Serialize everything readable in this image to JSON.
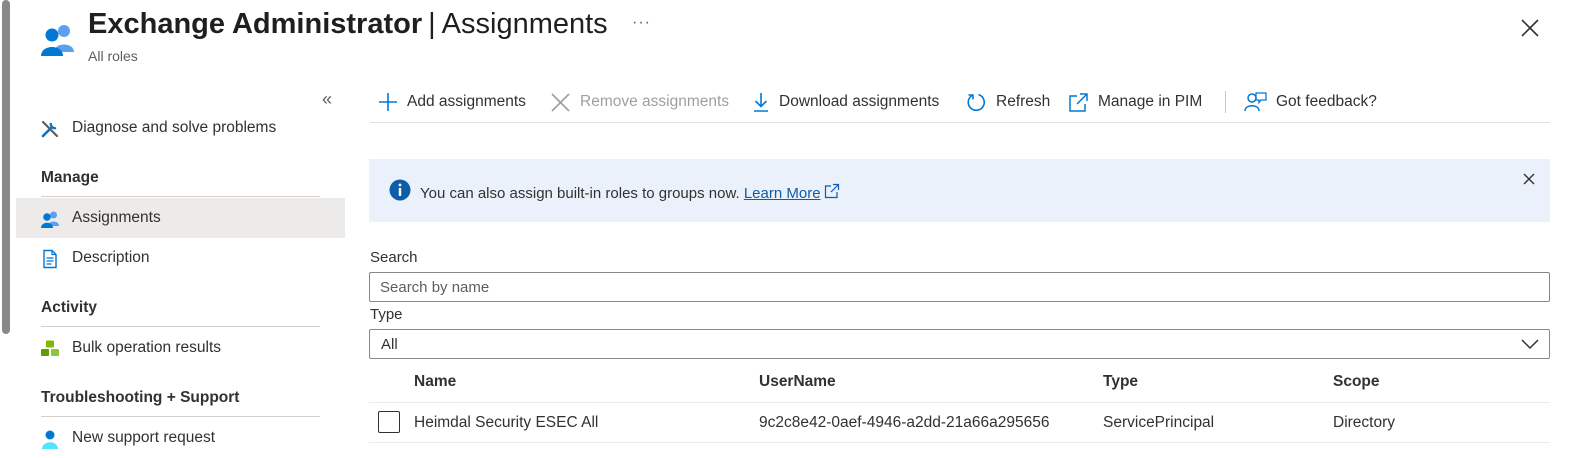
{
  "header": {
    "title_bold": "Exchange Administrator",
    "title_separator": "|",
    "title_section": "Assignments",
    "breadcrumb": "All roles",
    "more_label": "···"
  },
  "sidebar": {
    "collapse_label": "«",
    "top_items": [
      {
        "label": "Diagnose and solve problems",
        "icon": "wrench-icon"
      }
    ],
    "sections": [
      {
        "title": "Manage",
        "items": [
          {
            "label": "Assignments",
            "icon": "users-icon",
            "active": true
          },
          {
            "label": "Description",
            "icon": "document-icon",
            "active": false
          }
        ]
      },
      {
        "title": "Activity",
        "items": [
          {
            "label": "Bulk operation results",
            "icon": "cubes-icon",
            "active": false
          }
        ]
      },
      {
        "title": "Troubleshooting + Support",
        "items": [
          {
            "label": "New support request",
            "icon": "support-person-icon",
            "active": false
          }
        ]
      }
    ]
  },
  "toolbar": {
    "add": "Add assignments",
    "remove": "Remove assignments",
    "download": "Download assignments",
    "refresh": "Refresh",
    "manage_pim": "Manage in PIM",
    "feedback": "Got feedback?"
  },
  "banner": {
    "message": "You can also assign built-in roles to groups now.",
    "link": "Learn More"
  },
  "filters": {
    "search_label": "Search",
    "search_placeholder": "Search by name",
    "search_value": "",
    "type_label": "Type",
    "type_value": "All"
  },
  "table": {
    "columns": [
      "Name",
      "UserName",
      "Type",
      "Scope"
    ],
    "rows": [
      {
        "name": "Heimdal Security ESEC All",
        "username": "9c2c8e42-0aef-4946-a2dd-21a66a295656",
        "type": "ServicePrincipal",
        "scope": "Directory"
      }
    ]
  },
  "colors": {
    "accent": "#0078d4",
    "banner_bg": "#eaf1fb",
    "active_nav_bg": "#edebe9",
    "disabled_text": "#a19f9d"
  }
}
